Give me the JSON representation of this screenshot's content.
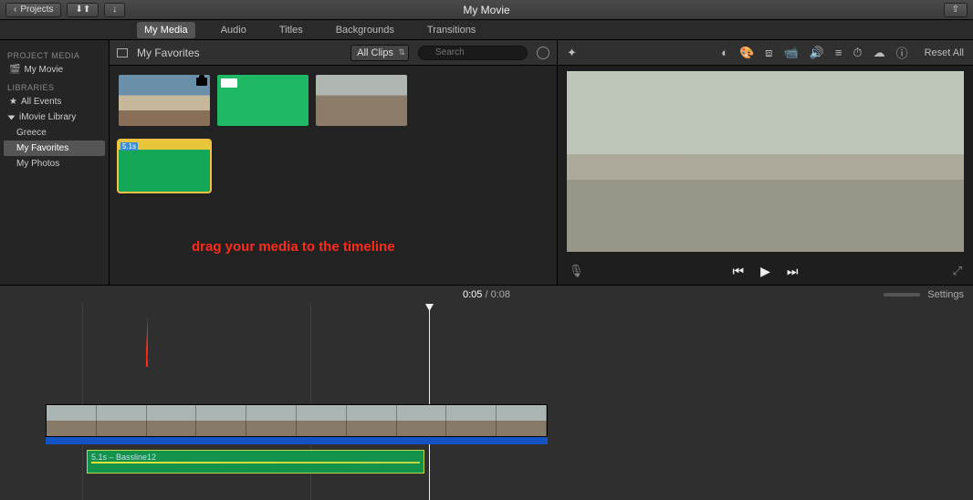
{
  "titlebar": {
    "back_label": "Projects",
    "title": "My Movie"
  },
  "tabs": {
    "my_media": "My Media",
    "audio": "Audio",
    "titles": "Titles",
    "backgrounds": "Backgrounds",
    "transitions": "Transitions"
  },
  "sidebar": {
    "hdr_project": "PROJECT MEDIA",
    "my_movie": "My Movie",
    "hdr_libraries": "LIBRARIES",
    "all_events": "All Events",
    "imovie_library": "iMovie Library",
    "sub_greece": "Greece",
    "sub_favorites": "My Favorites",
    "sub_photos": "My Photos"
  },
  "browser": {
    "crumb": "My Favorites",
    "filter": "All Clips",
    "search_placeholder": "Search",
    "clip4_tag": "5.1s"
  },
  "annotation": "drag your media to the timeline",
  "viewer": {
    "reset": "Reset All"
  },
  "timeline": {
    "time_current": "0:05",
    "time_total": " / 0:08",
    "settings": "Settings",
    "audio_label": "5.1s – Bassline12"
  }
}
